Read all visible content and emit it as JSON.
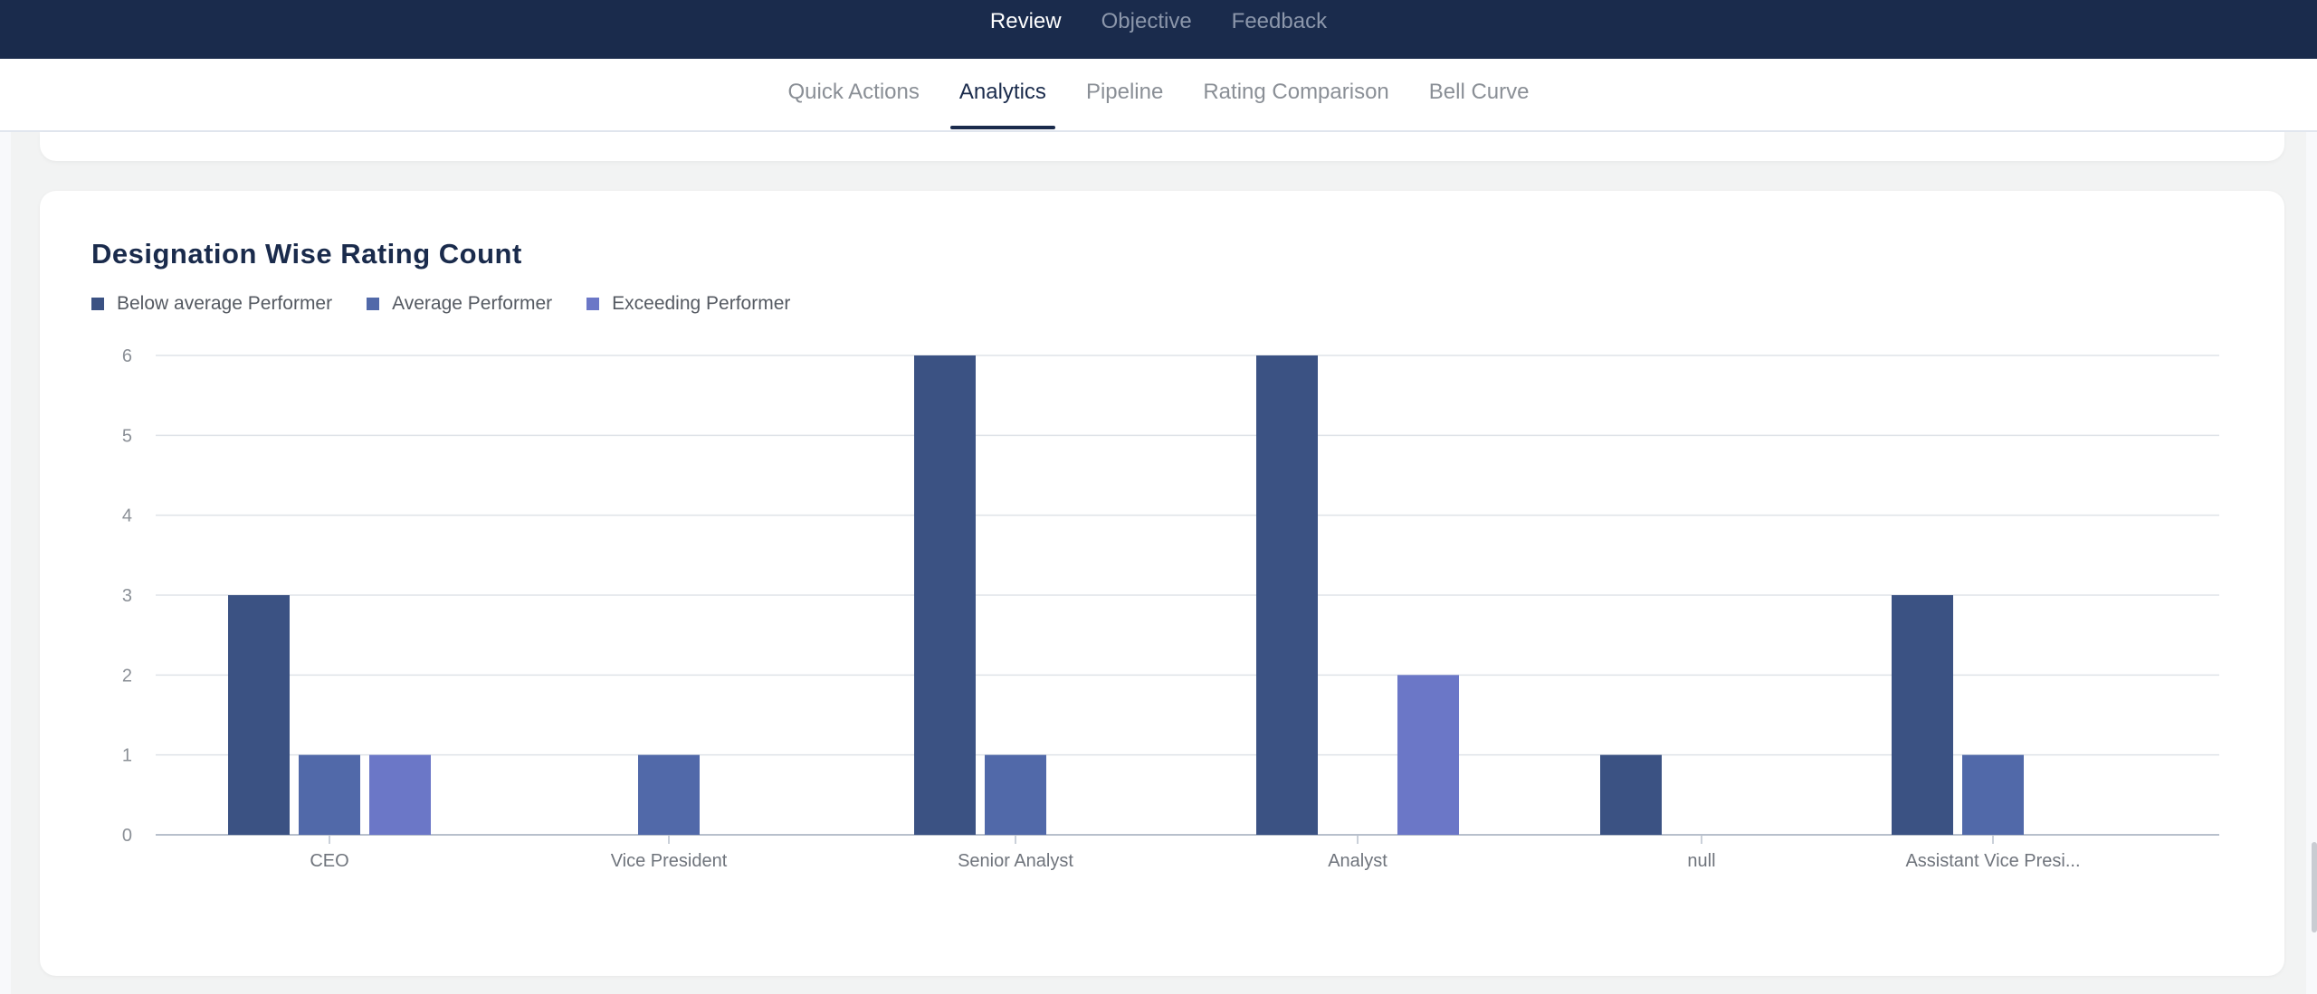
{
  "top_nav": {
    "tabs": [
      {
        "label": "Review",
        "active": true
      },
      {
        "label": "Objective",
        "active": false
      },
      {
        "label": "Feedback",
        "active": false
      }
    ]
  },
  "sub_nav": {
    "tabs": [
      {
        "label": "Quick Actions",
        "active": false
      },
      {
        "label": "Analytics",
        "active": true
      },
      {
        "label": "Pipeline",
        "active": false
      },
      {
        "label": "Rating Comparison",
        "active": false
      },
      {
        "label": "Bell Curve",
        "active": false
      }
    ]
  },
  "colors": {
    "nav_bg": "#1a2b4c",
    "series_below": "#3b5283",
    "series_average": "#5169a9",
    "series_exceeding": "#6b77c7"
  },
  "card": {
    "title": "Designation Wise Rating Count"
  },
  "chart_data": {
    "type": "bar",
    "title": "Designation Wise Rating Count",
    "xlabel": "",
    "ylabel": "",
    "ylim": [
      0,
      6
    ],
    "yticks": [
      0,
      1,
      2,
      3,
      4,
      5,
      6
    ],
    "grid": true,
    "legend_position": "top-left",
    "categories": [
      "CEO",
      "Vice President",
      "Senior Analyst",
      "Analyst",
      "null",
      "Assistant Vice Presi..."
    ],
    "series": [
      {
        "name": "Below average Performer",
        "color": "#3b5283",
        "values": [
          3,
          null,
          6,
          6,
          1,
          3
        ]
      },
      {
        "name": "Average Performer",
        "color": "#5169a9",
        "values": [
          1,
          1,
          1,
          null,
          null,
          1
        ]
      },
      {
        "name": "Exceeding Performer",
        "color": "#6b77c7",
        "values": [
          1,
          null,
          null,
          2,
          null,
          null
        ]
      }
    ]
  }
}
